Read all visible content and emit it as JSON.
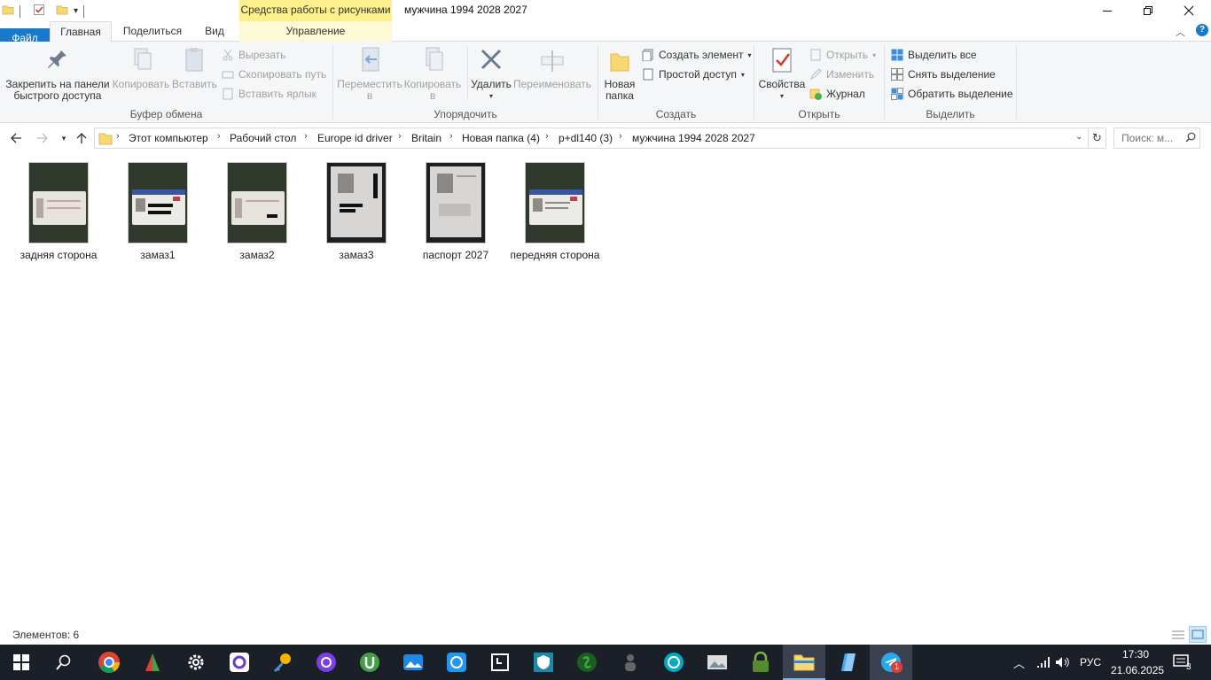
{
  "window": {
    "title": "мужчина 1994 2028 2027",
    "context_header": "Средства работы с рисунками"
  },
  "tabs": {
    "file": "Файл",
    "home": "Главная",
    "share": "Поделиться",
    "view": "Вид",
    "manage": "Управление"
  },
  "ribbon": {
    "clipboard": {
      "pin": "Закрепить на панели быстрого доступа",
      "pin_line1": "Закрепить на панели",
      "pin_line2": "быстрого доступа",
      "copy": "Копировать",
      "paste": "Вставить",
      "cut": "Вырезать",
      "copy_path": "Скопировать путь",
      "paste_shortcut": "Вставить ярлык",
      "label": "Буфер обмена"
    },
    "organize": {
      "move_line1": "Переместить",
      "move_line2": "в",
      "copy_line1": "Копировать",
      "copy_line2": "в",
      "delete": "Удалить",
      "rename": "Переименовать",
      "label": "Упорядочить"
    },
    "create": {
      "new_folder_line1": "Новая",
      "new_folder_line2": "папка",
      "new_item": "Создать элемент",
      "easy_access": "Простой доступ",
      "label": "Создать"
    },
    "open": {
      "properties": "Свойства",
      "open": "Открыть",
      "edit": "Изменить",
      "history": "Журнал",
      "label": "Открыть"
    },
    "select": {
      "select_all": "Выделить все",
      "select_none": "Снять выделение",
      "invert": "Обратить выделение",
      "label": "Выделить"
    }
  },
  "address": {
    "crumbs": [
      "Этот компьютер",
      "Рабочий стол",
      "Europe id driver",
      "Britain",
      "Новая папка (4)",
      "p+dl140 (3)",
      "мужчина 1994 2028 2027"
    ],
    "search_placeholder": "Поиск: м..."
  },
  "files": [
    {
      "name": "задняя сторона",
      "kind": "card-back"
    },
    {
      "name": "замаз1",
      "kind": "card-front"
    },
    {
      "name": "замаз2",
      "kind": "card-back"
    },
    {
      "name": "замаз3",
      "kind": "passport"
    },
    {
      "name": "паспорт 2027",
      "kind": "passport"
    },
    {
      "name": "передняя сторона",
      "kind": "card-front"
    }
  ],
  "status": {
    "items_count": "Элементов: 6"
  },
  "taskbar": {
    "apps": [
      "start-icon",
      "search-icon",
      "chrome-icon",
      "app-icon",
      "settings-icon",
      "app-icon",
      "key-app-icon",
      "browser-icon",
      "utorrent-icon",
      "photos-icon",
      "sync-icon",
      "app-icon",
      "shield-icon",
      "app-icon",
      "app-icon",
      "vpn-icon",
      "image-viewer-icon",
      "lock-icon",
      "file-explorer-icon",
      "notepad-icon",
      "telegram-icon"
    ],
    "language": "РУС",
    "time": "17:30",
    "date": "21.06.2025",
    "notifications": "3",
    "telegram_badge": "1"
  }
}
